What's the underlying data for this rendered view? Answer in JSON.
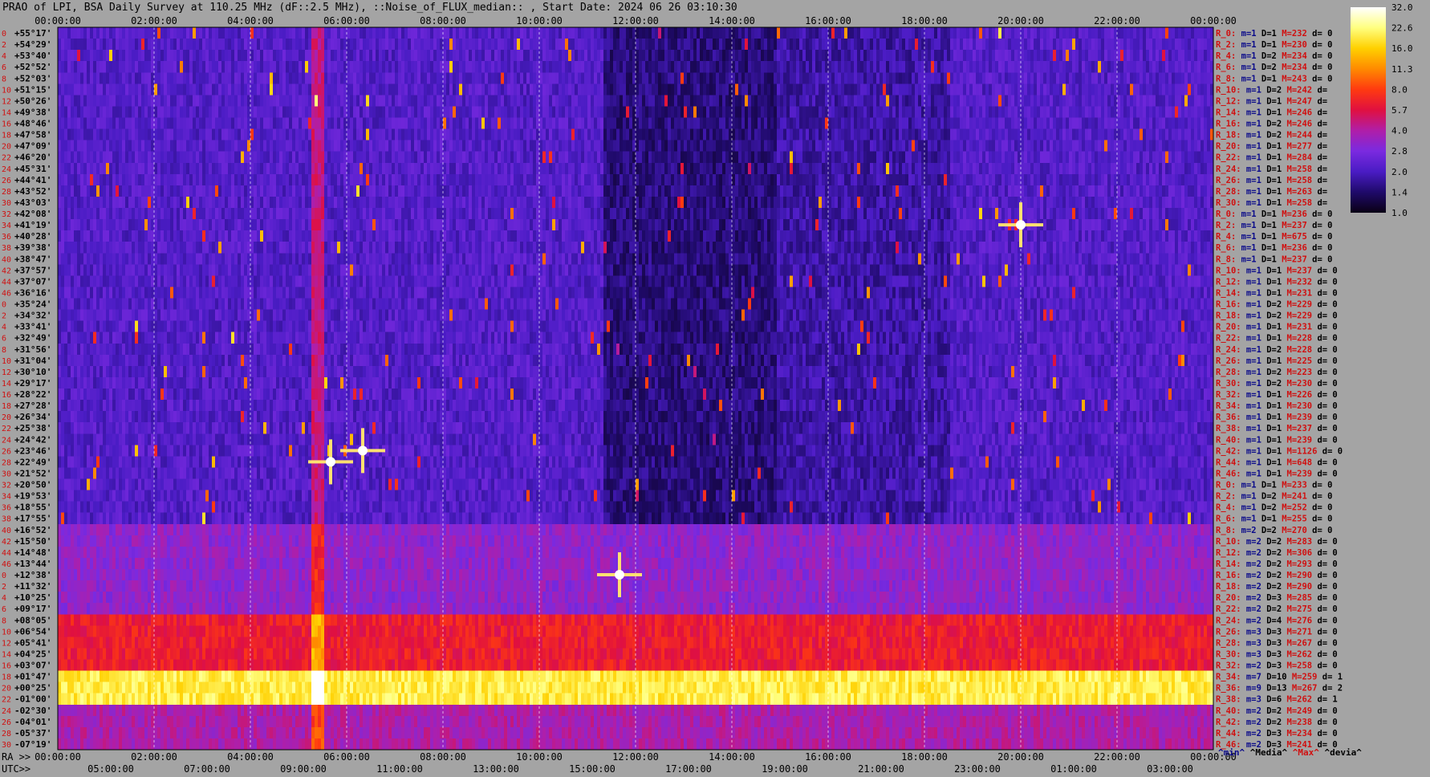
{
  "title": "PRAO of LPI, BSA Daily Survey at 110.25 MHz (dF::2.5 MHz), ::Noise_of_FLUX_median:: , Start Date: 2024 06 26 03:10:30",
  "chart_data": {
    "type": "heatmap",
    "title": "PRAO of LPI, BSA Daily Survey at 110.25 MHz (dF::2.5 MHz), ::Noise_of_FLUX_median:: , Start Date: 2024 06 26 03:10:30",
    "x_top_ticks": [
      "00:00:00",
      "02:00:00",
      "04:00:00",
      "06:00:00",
      "08:00:00",
      "10:00:00",
      "12:00:00",
      "14:00:00",
      "16:00:00",
      "18:00:00",
      "20:00:00",
      "22:00:00",
      "00:00:00"
    ],
    "x_bottom_ra_prefix": "RA >>",
    "x_bottom_ra_ticks": [
      "00:00:00",
      "02:00:00",
      "04:00:00",
      "06:00:00",
      "08:00:00",
      "10:00:00",
      "12:00:00",
      "14:00:00",
      "16:00:00",
      "18:00:00",
      "20:00:00",
      "22:00:00",
      "00:00:00"
    ],
    "x_bottom_utc_prefix": "UTC>>",
    "x_bottom_utc_ticks": [
      "05:00:00",
      "07:00:00",
      "09:00:00",
      "11:00:00",
      "13:00:00",
      "15:00:00",
      "17:00:00",
      "19:00:00",
      "21:00:00",
      "23:00:00",
      "01:00:00",
      "03:00:00"
    ],
    "y_index_labels": [
      "0",
      "2",
      "4",
      "6",
      "8",
      "10",
      "12",
      "14",
      "16",
      "18",
      "20",
      "22",
      "24",
      "26",
      "28",
      "30",
      "32",
      "34",
      "36",
      "38",
      "40",
      "42",
      "44",
      "46",
      "0",
      "2",
      "4",
      "6",
      "8",
      "10",
      "12",
      "14",
      "16",
      "18",
      "20",
      "22",
      "24",
      "26",
      "28",
      "30",
      "32",
      "34",
      "36",
      "38",
      "40",
      "42",
      "44",
      "46",
      "0",
      "2",
      "4",
      "6",
      "8",
      "10",
      "12",
      "14",
      "16",
      "18",
      "20",
      "22",
      "24",
      "26",
      "28",
      "30",
      "32",
      "34",
      "36",
      "38",
      "40",
      "42",
      "44",
      "46"
    ],
    "y_declination_labels": [
      "+55°17'",
      "+54°29'",
      "+53°40'",
      "+52°52'",
      "+52°03'",
      "+51°15'",
      "+50°26'",
      "+49°38'",
      "+48°46'",
      "+47°58'",
      "+47°09'",
      "+46°20'",
      "+45°31'",
      "+44°41'",
      "+43°52'",
      "+43°03'",
      "+42°08'",
      "+41°19'",
      "+40°28'",
      "+39°38'",
      "+38°47'",
      "+37°57'",
      "+37°07'",
      "+36°16'",
      "+35°24'",
      "+34°32'",
      "+33°41'",
      "+32°49'",
      "+31°56'",
      "+31°04'",
      "+30°10'",
      "+29°17'",
      "+28°22'",
      "+27°28'",
      "+26°34'",
      "+25°38'",
      "+24°42'",
      "+23°46'",
      "+22°49'",
      "+21°52'",
      "+20°50'",
      "+19°53'",
      "+18°55'",
      "+17°55'",
      "+16°52'",
      "+15°50'",
      "+14°48'",
      "+13°44'",
      "+12°38'",
      "+11°32'",
      "+10°25'",
      "+09°17'",
      "+08°05'",
      "+06°54'",
      "+05°41'",
      "+04°25'",
      "+03°07'",
      "+01°47'",
      "+00°25'",
      "-01°00'",
      "-02°30'",
      "-04°01'",
      "-05°37'",
      "-07°19'"
    ],
    "row_stats": [
      [
        "R_0:",
        "m=1",
        "D=1",
        "M=232",
        "d= 0"
      ],
      [
        "R_2:",
        "m=1",
        "D=1",
        "M=230",
        "d= 0"
      ],
      [
        "R_4:",
        "m=1",
        "D=2",
        "M=234",
        "d= 0"
      ],
      [
        "R_6:",
        "m=1",
        "D=2",
        "M=234",
        "d= 0"
      ],
      [
        "R_8:",
        "m=1",
        "D=1",
        "M=243",
        "d= 0"
      ],
      [
        "R_10:",
        "m=1",
        "D=2",
        "M=242",
        "d="
      ],
      [
        "R_12:",
        "m=1",
        "D=1",
        "M=247",
        "d="
      ],
      [
        "R_14:",
        "m=1",
        "D=1",
        "M=246",
        "d="
      ],
      [
        "R_16:",
        "m=1",
        "D=2",
        "M=246",
        "d="
      ],
      [
        "R_18:",
        "m=1",
        "D=2",
        "M=244",
        "d="
      ],
      [
        "R_20:",
        "m=1",
        "D=1",
        "M=277",
        "d="
      ],
      [
        "R_22:",
        "m=1",
        "D=1",
        "M=284",
        "d="
      ],
      [
        "R_24:",
        "m=1",
        "D=1",
        "M=258",
        "d="
      ],
      [
        "R_26:",
        "m=1",
        "D=1",
        "M=258",
        "d="
      ],
      [
        "R_28:",
        "m=1",
        "D=1",
        "M=263",
        "d="
      ],
      [
        "R_30:",
        "m=1",
        "D=1",
        "M=258",
        "d="
      ],
      [
        "R_0:",
        "m=1",
        "D=1",
        "M=236",
        "d= 0"
      ],
      [
        "R_2:",
        "m=1",
        "D=1",
        "M=237",
        "d= 0"
      ],
      [
        "R_4:",
        "m=1",
        "D=1",
        "M=675",
        "d= 0"
      ],
      [
        "R_6:",
        "m=1",
        "D=1",
        "M=236",
        "d= 0"
      ],
      [
        "R_8:",
        "m=1",
        "D=1",
        "M=237",
        "d= 0"
      ],
      [
        "R_10:",
        "m=1",
        "D=1",
        "M=237",
        "d= 0"
      ],
      [
        "R_12:",
        "m=1",
        "D=1",
        "M=232",
        "d= 0"
      ],
      [
        "R_14:",
        "m=1",
        "D=1",
        "M=231",
        "d= 0"
      ],
      [
        "R_16:",
        "m=1",
        "D=2",
        "M=229",
        "d= 0"
      ],
      [
        "R_18:",
        "m=1",
        "D=2",
        "M=229",
        "d= 0"
      ],
      [
        "R_20:",
        "m=1",
        "D=1",
        "M=231",
        "d= 0"
      ],
      [
        "R_22:",
        "m=1",
        "D=1",
        "M=228",
        "d= 0"
      ],
      [
        "R_24:",
        "m=1",
        "D=2",
        "M=228",
        "d= 0"
      ],
      [
        "R_26:",
        "m=1",
        "D=1",
        "M=225",
        "d= 0"
      ],
      [
        "R_28:",
        "m=1",
        "D=2",
        "M=223",
        "d= 0"
      ],
      [
        "R_30:",
        "m=1",
        "D=2",
        "M=230",
        "d= 0"
      ],
      [
        "R_32:",
        "m=1",
        "D=1",
        "M=226",
        "d= 0"
      ],
      [
        "R_34:",
        "m=1",
        "D=1",
        "M=230",
        "d= 0"
      ],
      [
        "R_36:",
        "m=1",
        "D=1",
        "M=239",
        "d= 0"
      ],
      [
        "R_38:",
        "m=1",
        "D=1",
        "M=237",
        "d= 0"
      ],
      [
        "R_40:",
        "m=1",
        "D=1",
        "M=239",
        "d= 0"
      ],
      [
        "R_42:",
        "m=1",
        "D=1",
        "M=1126",
        "d= 0"
      ],
      [
        "R_44:",
        "m=1",
        "D=1",
        "M=648",
        "d= 0"
      ],
      [
        "R_46:",
        "m=1",
        "D=1",
        "M=239",
        "d= 0"
      ],
      [
        "R_0:",
        "m=1",
        "D=1",
        "M=233",
        "d= 0"
      ],
      [
        "R_2:",
        "m=1",
        "D=2",
        "M=241",
        "d= 0"
      ],
      [
        "R_4:",
        "m=1",
        "D=2",
        "M=252",
        "d= 0"
      ],
      [
        "R_6:",
        "m=1",
        "D=1",
        "M=255",
        "d= 0"
      ],
      [
        "R_8:",
        "m=2",
        "D=2",
        "M=270",
        "d= 0"
      ],
      [
        "R_10:",
        "m=2",
        "D=2",
        "M=283",
        "d= 0"
      ],
      [
        "R_12:",
        "m=2",
        "D=2",
        "M=306",
        "d= 0"
      ],
      [
        "R_14:",
        "m=2",
        "D=2",
        "M=293",
        "d= 0"
      ],
      [
        "R_16:",
        "m=2",
        "D=2",
        "M=290",
        "d= 0"
      ],
      [
        "R_18:",
        "m=2",
        "D=2",
        "M=290",
        "d= 0"
      ],
      [
        "R_20:",
        "m=2",
        "D=3",
        "M=285",
        "d= 0"
      ],
      [
        "R_22:",
        "m=2",
        "D=2",
        "M=275",
        "d= 0"
      ],
      [
        "R_24:",
        "m=2",
        "D=4",
        "M=276",
        "d= 0"
      ],
      [
        "R_26:",
        "m=3",
        "D=3",
        "M=271",
        "d= 0"
      ],
      [
        "R_28:",
        "m=3",
        "D=3",
        "M=267",
        "d= 0"
      ],
      [
        "R_30:",
        "m=3",
        "D=3",
        "M=262",
        "d= 0"
      ],
      [
        "R_32:",
        "m=2",
        "D=3",
        "M=258",
        "d= 0"
      ],
      [
        "R_34:",
        "m=7",
        "D=10",
        "M=259",
        "d= 1"
      ],
      [
        "R_36:",
        "m=9",
        "D=13",
        "M=267",
        "d= 2"
      ],
      [
        "R_38:",
        "m=3",
        "D=6",
        "M=262",
        "d= 1"
      ],
      [
        "R_40:",
        "m=2",
        "D=2",
        "M=249",
        "d= 0"
      ],
      [
        "R_42:",
        "m=2",
        "D=2",
        "M=238",
        "d= 0"
      ],
      [
        "R_44:",
        "m=2",
        "D=3",
        "M=234",
        "d= 0"
      ],
      [
        "R_46:",
        "m=2",
        "D=3",
        "M=241",
        "d= 0"
      ]
    ],
    "legend_footer": [
      "^min^",
      "^Media^",
      "^Max^",
      "^devia^"
    ],
    "colorbar_ticks": [
      "32.0",
      "22.6",
      "16.0",
      "11.3",
      "8.0",
      "5.7",
      "4.0",
      "2.8",
      "2.0",
      "1.4",
      "1.0"
    ],
    "colormap": [
      "#0a0014",
      "#1f0a6a",
      "#4a1cc4",
      "#7a2ae0",
      "#b01ea8",
      "#e01040",
      "#ff3a10",
      "#ff8a00",
      "#ffd000",
      "#ffff80",
      "#ffffff"
    ],
    "bands": [
      {
        "rows": [
          0,
          43
        ],
        "level": "low"
      },
      {
        "rows": [
          44,
          51
        ],
        "level": "medium"
      },
      {
        "rows": [
          52,
          56
        ],
        "level": "high"
      },
      {
        "rows": [
          57,
          59
        ],
        "level": "max"
      },
      {
        "rows": [
          60,
          63
        ],
        "level": "medium-high"
      }
    ],
    "bright_sources": [
      {
        "ra": "20:00:00",
        "dec": "+41°19'"
      },
      {
        "ra": "06:20:00",
        "dec": "+23°46'"
      },
      {
        "ra": "05:40:00",
        "dec": "+22°49'"
      },
      {
        "ra": "11:40:00",
        "dec": "+12°38'"
      }
    ]
  }
}
